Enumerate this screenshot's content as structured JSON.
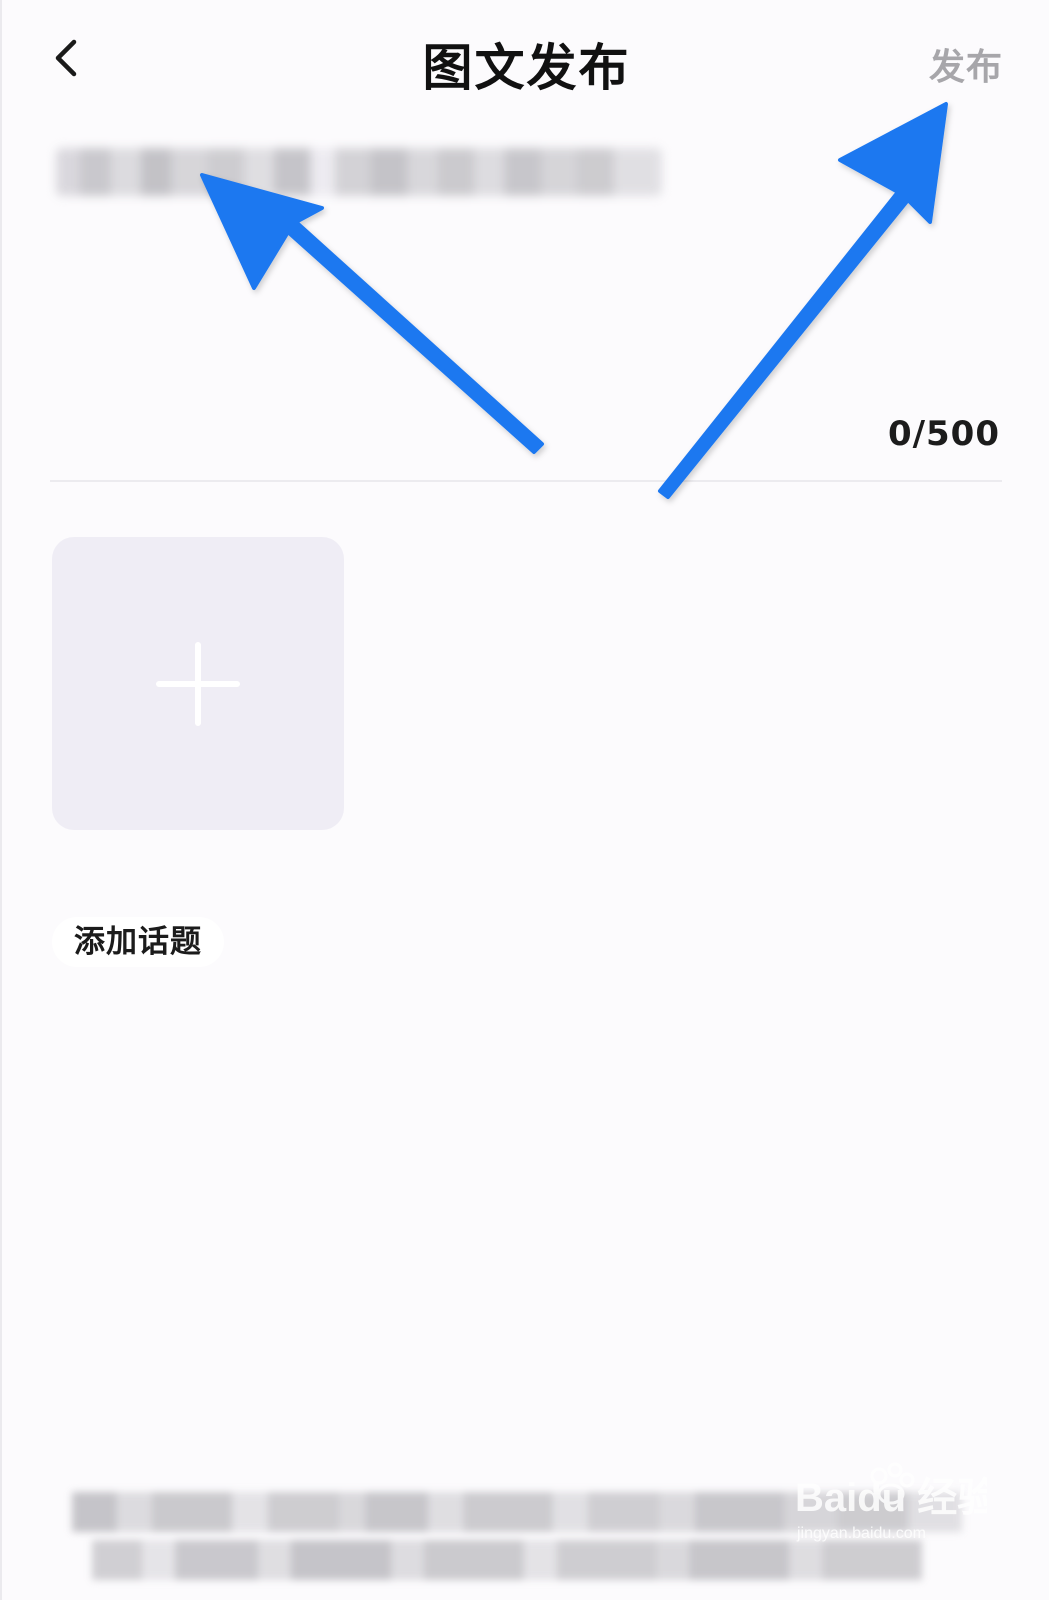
{
  "header": {
    "back_icon": "chevron-left-icon",
    "title": "图文发布",
    "publish_label": "发布"
  },
  "editor": {
    "counter": "0/500"
  },
  "media": {
    "add_icon": "plus-icon"
  },
  "topic": {
    "label": "添加话题"
  },
  "watermark": {
    "brand": "Baidu 经验",
    "url": "jingyan.baidu.com"
  },
  "colors": {
    "background": "#fcfbfd",
    "title": "#111111",
    "publish_disabled": "#a7a6aa",
    "tile_bg": "#efedf5",
    "annotation_arrow": "#1e78f0"
  }
}
